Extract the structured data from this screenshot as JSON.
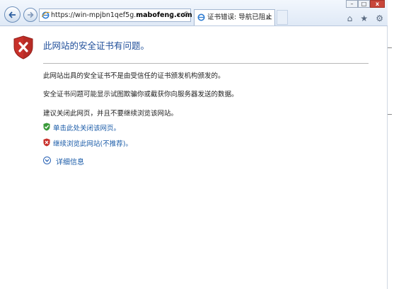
{
  "browser": {
    "url_prefix": "https://win-mpjbn1qef5g.",
    "url_domain": "mabofeng.com",
    "address_tools": "ρ ▾ C",
    "tab_title": "证书错误: 导航已阻止",
    "tab_close": "×",
    "window_controls": {
      "minimize": "–",
      "maximize": "□",
      "close": "x"
    },
    "tool_icons": [
      "home-icon",
      "star-icon",
      "gear-icon"
    ]
  },
  "page": {
    "heading": "此网站的安全证书有问题。",
    "paragraph1": "此网站出具的安全证书不是由受信任的证书颁发机构颁发的。",
    "paragraph2": "安全证书问题可能显示试图欺骗你或截获你向服务器发送的数据。",
    "paragraph3": "建议关闭此网页，并且不要继续浏览该网站。",
    "link_close": "单击此处关闭该网页。",
    "link_continue": "继续浏览此网站(不推荐)。",
    "details": "详细信息"
  },
  "colors": {
    "heading": "#1f4e9a",
    "link": "#1a5ba8",
    "shield_red": "#c8302a",
    "shield_green": "#3a9a3a"
  }
}
